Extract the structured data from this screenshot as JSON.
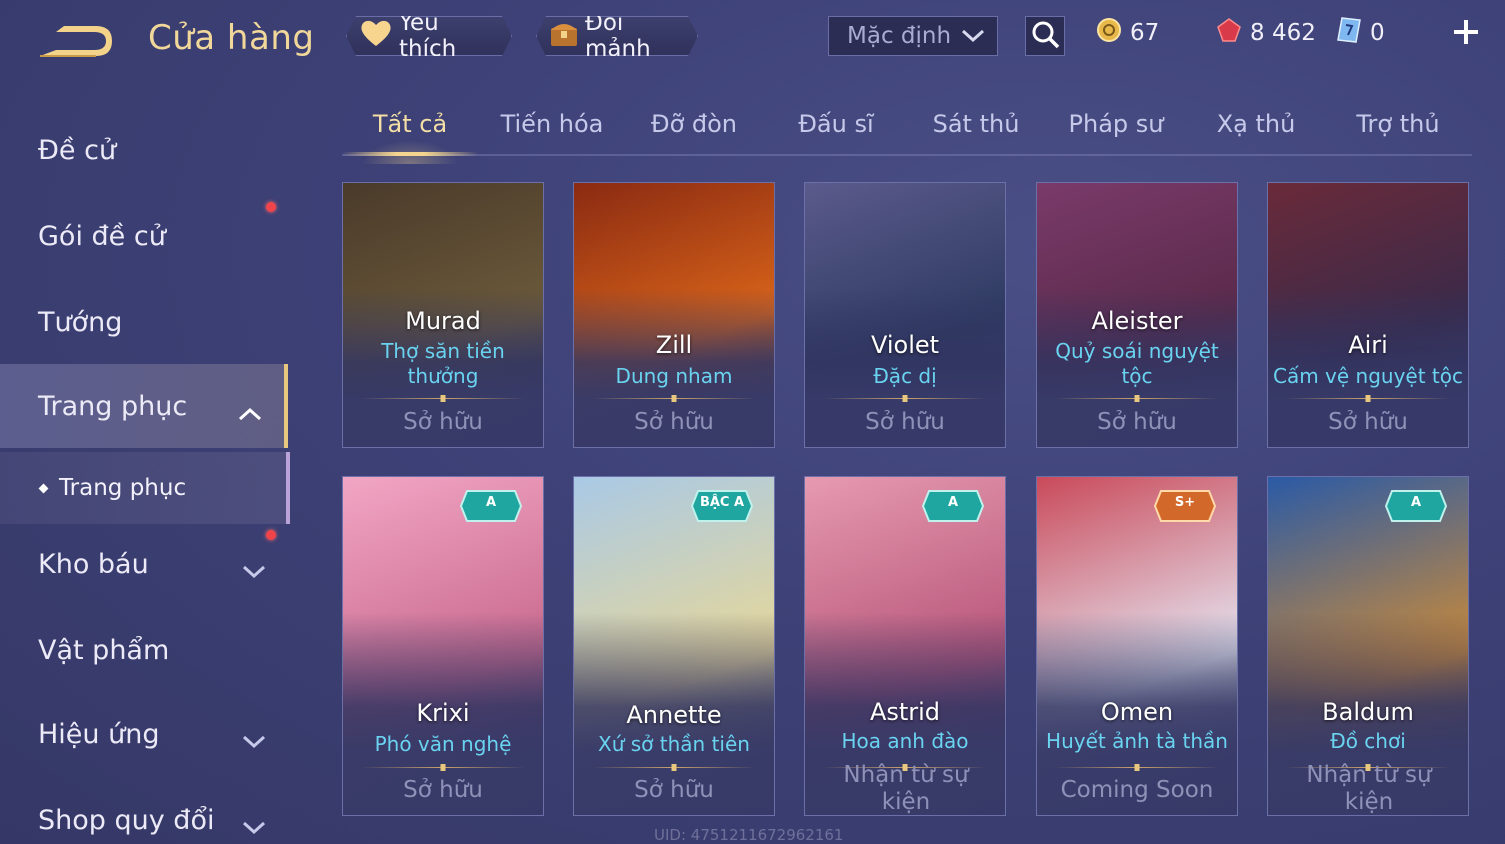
{
  "header": {
    "title": "Cửa hàng",
    "favorite_label": "Yêu thích",
    "exchange_label": "Đổi mảnh",
    "sort_value": "Mặc định",
    "currencies": {
      "gold": "67",
      "ruby": "8 462",
      "voucher": "0"
    }
  },
  "sidebar": {
    "items": [
      {
        "label": "Đề cử"
      },
      {
        "label": "Gói đề cử"
      },
      {
        "label": "Tướng"
      },
      {
        "label": "Trang phục"
      },
      {
        "label": "Kho báu"
      },
      {
        "label": "Vật phẩm"
      },
      {
        "label": "Hiệu ứng"
      },
      {
        "label": "Shop quy đổi"
      }
    ],
    "sub_item": "Trang phục"
  },
  "tabs": [
    "Tất cả",
    "Tiến hóa",
    "Đỡ đòn",
    "Đấu sĩ",
    "Sát thủ",
    "Pháp sư",
    "Xạ thủ",
    "Trợ thủ"
  ],
  "cards": [
    {
      "hero": "Murad",
      "skin": "Thợ săn tiền thưởng",
      "status": "Sở hữu",
      "badge": "",
      "art_color_top": "#4a3a2a",
      "art_color_bottom": "#6b5a3a"
    },
    {
      "hero": "Zill",
      "skin": "Dung nham",
      "status": "Sở hữu",
      "badge": "",
      "art_color_top": "#8a2a12",
      "art_color_bottom": "#d9641a"
    },
    {
      "hero": "Violet",
      "skin": "Đặc dị",
      "status": "Sở hữu",
      "badge": "",
      "art_color_top": "#5b5a8c",
      "art_color_bottom": "#2e3b62"
    },
    {
      "hero": "Aleister",
      "skin": "Quỷ soái nguyệt tộc",
      "status": "Sở hữu",
      "badge": "",
      "art_color_top": "#7a3a6a",
      "art_color_bottom": "#5a2a4a"
    },
    {
      "hero": "Airi",
      "skin": "Cấm vệ nguyệt tộc",
      "status": "Sở hữu",
      "badge": "",
      "art_color_top": "#6a2a3a",
      "art_color_bottom": "#3a2a4a"
    },
    {
      "hero": "Krixi",
      "skin": "Phó văn nghệ",
      "status": "Sở hữu",
      "badge": "A",
      "art_color_top": "#f2a5c4",
      "art_color_bottom": "#c96a8e"
    },
    {
      "hero": "Annette",
      "skin": "Xứ sở thần tiên",
      "status": "Sở hữu",
      "badge": "BẬC A",
      "art_color_top": "#a9c9e6",
      "art_color_bottom": "#e6d79a"
    },
    {
      "hero": "Astrid",
      "skin": "Hoa anh đào",
      "status": "Nhận từ sự kiện",
      "badge": "A",
      "art_color_top": "#e69ab0",
      "art_color_bottom": "#b8567a"
    },
    {
      "hero": "Omen",
      "skin": "Huyết ảnh tà thần",
      "status": "Coming Soon",
      "badge": "S+",
      "art_color_top": "#c94a5a",
      "art_color_bottom": "#e6e6f2"
    },
    {
      "hero": "Baldum",
      "skin": "Đồ chơi",
      "status": "Nhận từ sự kiện",
      "badge": "A",
      "art_color_top": "#2a5aa6",
      "art_color_bottom": "#c98a3a"
    }
  ],
  "uid_text": "UID: 4751211672962161",
  "colors": {
    "accent_gold": "#f1d79a",
    "skin_name": "#69d3f0",
    "badge_teal": "#1fa6a0",
    "badge_orange": "#d2682a"
  }
}
